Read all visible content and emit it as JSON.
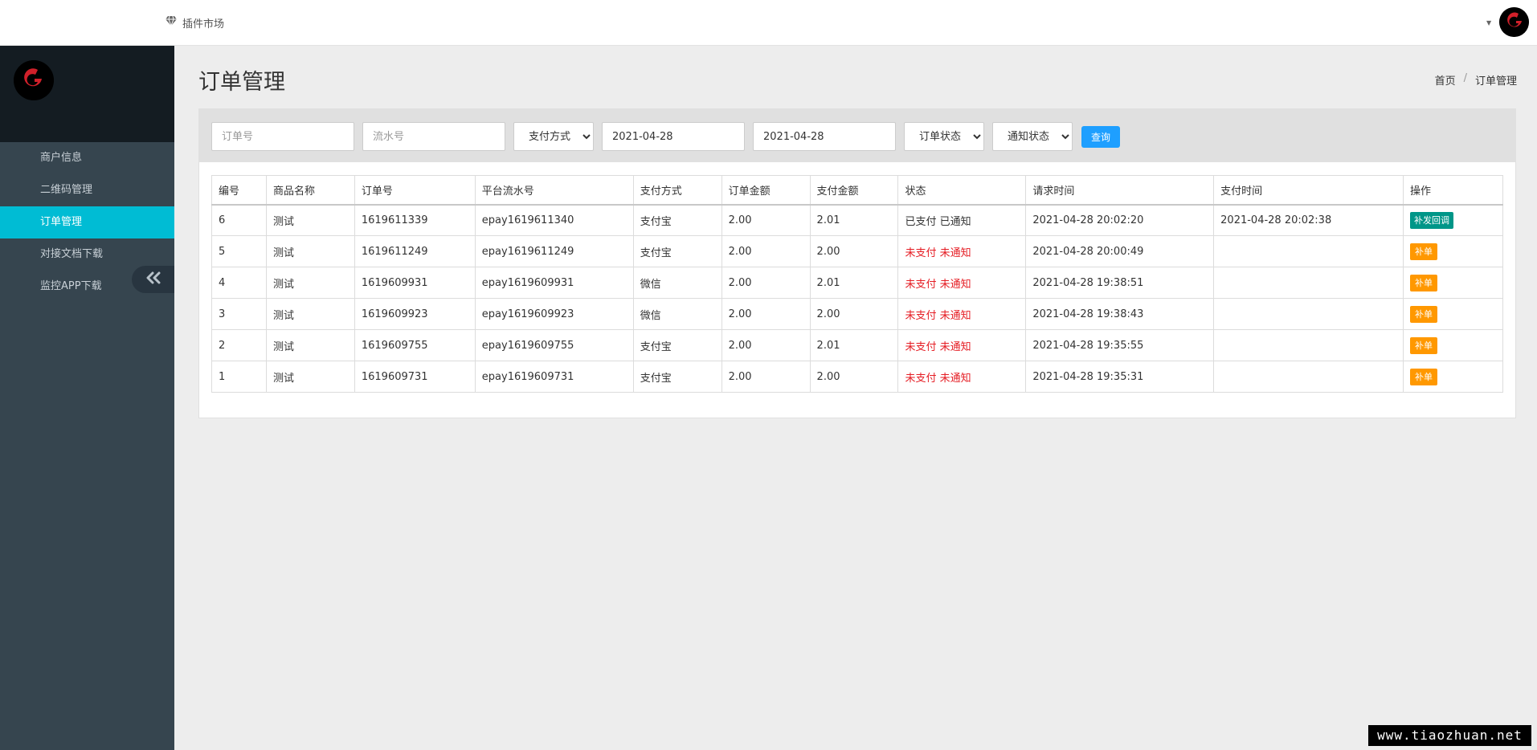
{
  "topbar": {
    "plugin_market": "插件市场"
  },
  "sidebar": {
    "items": [
      {
        "label": "商户信息"
      },
      {
        "label": "二维码管理"
      },
      {
        "label": "订单管理"
      },
      {
        "label": "对接文档下载"
      },
      {
        "label": "监控APP下载"
      }
    ]
  },
  "page": {
    "title": "订单管理",
    "breadcrumb_home": "首页",
    "breadcrumb_sep": "/",
    "breadcrumb_current": "订单管理"
  },
  "filters": {
    "order_no_placeholder": "订单号",
    "serial_no_placeholder": "流水号",
    "pay_method": "支付方式",
    "start_date": "2021-04-28",
    "end_date": "2021-04-28",
    "order_status": "订单状态",
    "notify_status": "通知状态",
    "search_label": "查询"
  },
  "table": {
    "headers": [
      "编号",
      "商品名称",
      "订单号",
      "平台流水号",
      "支付方式",
      "订单金额",
      "支付金额",
      "状态",
      "请求时间",
      "支付时间",
      "操作"
    ],
    "rows": [
      {
        "id": "6",
        "name": "测试",
        "order_no": "1619611339",
        "serial": "epay1619611340",
        "method": "支付宝",
        "amount": "2.00",
        "paid": "2.01",
        "status": "已支付 已通知",
        "status_alert": false,
        "req_time": "2021-04-28 20:02:20",
        "pay_time": "2021-04-28 20:02:38",
        "action": "补发回调",
        "action_type": "green"
      },
      {
        "id": "5",
        "name": "测试",
        "order_no": "1619611249",
        "serial": "epay1619611249",
        "method": "支付宝",
        "amount": "2.00",
        "paid": "2.00",
        "status": "未支付 未通知",
        "status_alert": true,
        "req_time": "2021-04-28 20:00:49",
        "pay_time": "",
        "action": "补单",
        "action_type": "orange"
      },
      {
        "id": "4",
        "name": "测试",
        "order_no": "1619609931",
        "serial": "epay1619609931",
        "method": "微信",
        "amount": "2.00",
        "paid": "2.01",
        "status": "未支付 未通知",
        "status_alert": true,
        "req_time": "2021-04-28 19:38:51",
        "pay_time": "",
        "action": "补单",
        "action_type": "orange"
      },
      {
        "id": "3",
        "name": "测试",
        "order_no": "1619609923",
        "serial": "epay1619609923",
        "method": "微信",
        "amount": "2.00",
        "paid": "2.00",
        "status": "未支付 未通知",
        "status_alert": true,
        "req_time": "2021-04-28 19:38:43",
        "pay_time": "",
        "action": "补单",
        "action_type": "orange"
      },
      {
        "id": "2",
        "name": "测试",
        "order_no": "1619609755",
        "serial": "epay1619609755",
        "method": "支付宝",
        "amount": "2.00",
        "paid": "2.01",
        "status": "未支付 未通知",
        "status_alert": true,
        "req_time": "2021-04-28 19:35:55",
        "pay_time": "",
        "action": "补单",
        "action_type": "orange"
      },
      {
        "id": "1",
        "name": "测试",
        "order_no": "1619609731",
        "serial": "epay1619609731",
        "method": "支付宝",
        "amount": "2.00",
        "paid": "2.00",
        "status": "未支付 未通知",
        "status_alert": true,
        "req_time": "2021-04-28 19:35:31",
        "pay_time": "",
        "action": "补单",
        "action_type": "orange"
      }
    ]
  },
  "watermark": "www.tiaozhuan.net",
  "colors": {
    "sidebar_bg": "#36454f",
    "sidebar_active": "#00bcd4",
    "search_btn": "#1e9fff",
    "btn_green": "#009688",
    "btn_orange": "#ff9800",
    "status_red": "#e51c23"
  },
  "icons": {
    "plugin": "diamond-icon",
    "collapse": "double-chevron-left-icon"
  }
}
